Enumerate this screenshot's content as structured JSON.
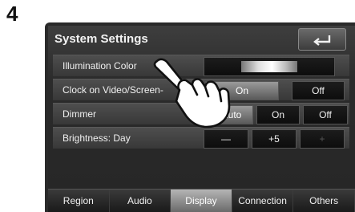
{
  "step_number": "4",
  "screen": {
    "title": "System Settings",
    "back_icon": "back-arrow-icon",
    "rows": [
      {
        "label": "Illumination Color",
        "control": "color-swatch"
      },
      {
        "label": "Clock on Video/Screen-",
        "options": [
          "On",
          "Off"
        ],
        "selected": "On"
      },
      {
        "label": "Dimmer",
        "options": [
          "Auto",
          "On",
          "Off"
        ],
        "selected": "Auto"
      },
      {
        "label": "Brightness: Day",
        "minus": "—",
        "value": "+5",
        "plus": "+"
      }
    ],
    "tabs": [
      "Region",
      "Audio",
      "Display",
      "Connection",
      "Others"
    ],
    "active_tab": "Display"
  },
  "overlay_icon": "pointing-hand-icon"
}
